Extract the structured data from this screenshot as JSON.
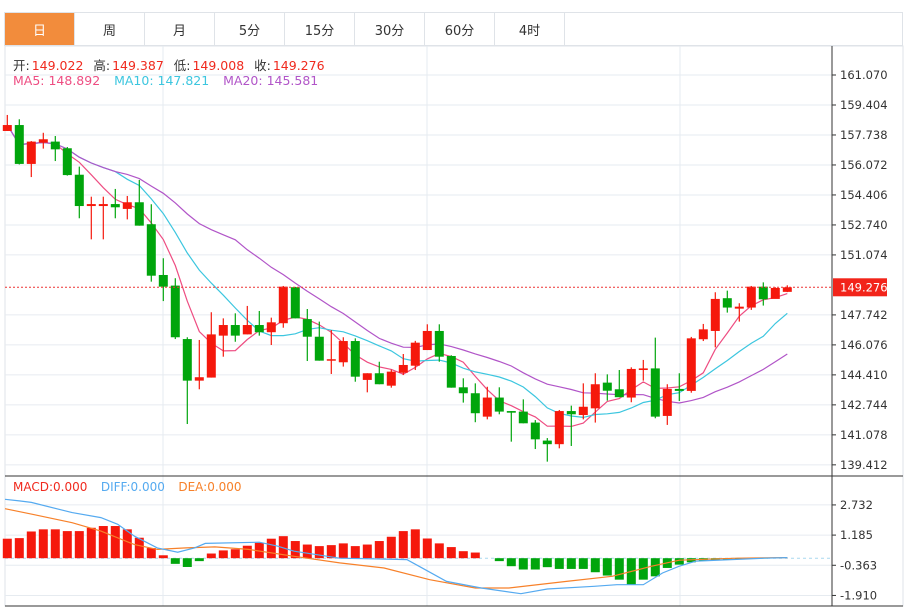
{
  "tabs": [
    {
      "label": "日",
      "active": true
    },
    {
      "label": "周"
    },
    {
      "label": "月"
    },
    {
      "label": "5分"
    },
    {
      "label": "15分"
    },
    {
      "label": "30分"
    },
    {
      "label": "60分"
    },
    {
      "label": "4时"
    }
  ],
  "ohlc_legend": {
    "open_label": "开:",
    "open": "149.022",
    "high_label": "高:",
    "high": "149.387",
    "low_label": "低:",
    "low": "149.008",
    "close_label": "收:",
    "close": "149.276"
  },
  "ma_legend": {
    "ma5": "MA5: 148.892",
    "ma10": "MA10: 147.821",
    "ma20": "MA20: 145.581"
  },
  "macd_legend": {
    "macd": "MACD:0.000",
    "diff": "DIFF:0.000",
    "dea": "DEA:0.000"
  },
  "colors": {
    "up": "#f5180c",
    "down": "#00a50c",
    "ma5": "#ee4d82",
    "ma10": "#3cc6df",
    "ma20": "#b155c8",
    "diff": "#55aaf0",
    "dea": "#f7812a",
    "accent": "#f28c3c",
    "grid": "#e6ebf0"
  },
  "chart_data": [
    {
      "type": "candlestick",
      "title": "",
      "ylim": [
        139.412,
        161.07
      ],
      "y_ticks": [
        "161.070",
        "159.404",
        "157.738",
        "156.072",
        "154.406",
        "152.740",
        "151.074",
        "147.742",
        "146.076",
        "144.410",
        "142.744",
        "141.078",
        "139.412"
      ],
      "current_price": "149.276",
      "ohlc": [
        [
          157.96,
          158.85,
          157.96,
          158.29
        ],
        [
          158.29,
          158.61,
          156.1,
          156.13
        ],
        [
          156.13,
          157.4,
          155.4,
          157.37
        ],
        [
          157.31,
          157.86,
          156.98,
          157.5
        ],
        [
          157.37,
          157.68,
          156.29,
          156.94
        ],
        [
          157.0,
          157.07,
          155.48,
          155.51
        ],
        [
          155.53,
          155.98,
          153.11,
          153.79
        ],
        [
          153.79,
          154.31,
          151.94,
          153.9
        ],
        [
          153.79,
          154.31,
          151.94,
          153.9
        ],
        [
          153.9,
          154.74,
          153.11,
          153.72
        ],
        [
          153.63,
          154.35,
          153.05,
          154.0
        ],
        [
          154.0,
          155.24,
          152.7,
          152.7
        ],
        [
          152.78,
          153.89,
          149.59,
          149.92
        ],
        [
          149.96,
          150.89,
          148.51,
          149.31
        ],
        [
          149.37,
          149.78,
          146.4,
          146.5
        ],
        [
          146.4,
          146.5,
          141.68,
          144.09
        ],
        [
          144.09,
          146.35,
          143.61,
          144.28
        ],
        [
          144.26,
          147.89,
          144.26,
          146.66
        ],
        [
          146.59,
          147.55,
          145.42,
          147.18
        ],
        [
          147.18,
          147.83,
          146.25,
          146.59
        ],
        [
          146.66,
          148.24,
          146.66,
          147.18
        ],
        [
          147.18,
          147.96,
          146.59,
          146.78
        ],
        [
          146.78,
          147.59,
          146.07,
          147.33
        ],
        [
          147.28,
          149.35,
          147.03,
          149.31
        ],
        [
          149.28,
          149.3,
          147.55,
          147.55
        ],
        [
          147.51,
          148.07,
          145.18,
          146.53
        ],
        [
          146.53,
          147.37,
          145.2,
          145.2
        ],
        [
          145.2,
          146.9,
          144.46,
          145.28
        ],
        [
          145.11,
          146.5,
          144.87,
          146.29
        ],
        [
          146.29,
          146.44,
          144.03,
          144.31
        ],
        [
          144.13,
          144.5,
          143.44,
          144.5
        ],
        [
          144.5,
          145.14,
          143.89,
          143.89
        ],
        [
          143.81,
          144.7,
          143.7,
          144.59
        ],
        [
          144.53,
          145.57,
          144.4,
          144.96
        ],
        [
          144.92,
          146.3,
          144.68,
          146.2
        ],
        [
          145.79,
          147.22,
          145.79,
          146.85
        ],
        [
          146.85,
          147.22,
          145.14,
          145.42
        ],
        [
          145.46,
          145.5,
          143.7,
          143.7
        ],
        [
          143.72,
          144.22,
          142.87,
          143.39
        ],
        [
          143.39,
          143.94,
          141.78,
          142.28
        ],
        [
          142.09,
          143.75,
          141.94,
          143.15
        ],
        [
          143.15,
          143.72,
          142.22,
          142.37
        ],
        [
          142.4,
          142.4,
          140.7,
          142.31
        ],
        [
          142.37,
          143.05,
          141.72,
          141.72
        ],
        [
          141.76,
          141.9,
          140.29,
          140.83
        ],
        [
          140.76,
          140.9,
          139.59,
          140.56
        ],
        [
          140.56,
          142.46,
          140.33,
          142.4
        ],
        [
          142.4,
          142.7,
          140.46,
          142.22
        ],
        [
          142.18,
          143.94,
          141.94,
          142.64
        ],
        [
          142.55,
          144.5,
          141.76,
          143.89
        ],
        [
          143.98,
          144.44,
          142.98,
          143.53
        ],
        [
          143.61,
          144.68,
          143.17,
          143.17
        ],
        [
          143.15,
          144.83,
          142.89,
          144.74
        ],
        [
          144.68,
          145.24,
          144.09,
          144.77
        ],
        [
          144.77,
          146.48,
          142.0,
          142.09
        ],
        [
          142.13,
          143.89,
          141.63,
          143.63
        ],
        [
          143.63,
          144.5,
          142.96,
          143.52
        ],
        [
          143.52,
          146.52,
          143.42,
          146.44
        ],
        [
          146.39,
          147.24,
          146.29,
          146.94
        ],
        [
          146.85,
          149.0,
          145.94,
          148.63
        ],
        [
          148.67,
          149.09,
          147.87,
          148.15
        ],
        [
          148.09,
          148.39,
          147.37,
          148.2
        ],
        [
          148.15,
          149.35,
          148.02,
          149.31
        ],
        [
          149.31,
          149.55,
          148.26,
          148.61
        ],
        [
          148.63,
          149.28,
          148.72,
          149.24
        ],
        [
          149.022,
          149.387,
          149.008,
          149.276
        ]
      ],
      "ma_periods": [
        5,
        10,
        20
      ]
    },
    {
      "type": "bar+line",
      "title": "MACD",
      "ylim": [
        -2.2,
        3.2
      ],
      "y_ticks": [
        "2.732",
        "1.185",
        "-0.363",
        "-1.910"
      ],
      "histogram": [
        1.0,
        1.03,
        1.37,
        1.48,
        1.48,
        1.39,
        1.39,
        1.56,
        1.65,
        1.65,
        1.48,
        1.05,
        0.52,
        0.15,
        -0.29,
        -0.45,
        -0.15,
        0.24,
        0.4,
        0.46,
        0.64,
        0.79,
        1.0,
        1.13,
        0.88,
        0.7,
        0.62,
        0.67,
        0.76,
        0.62,
        0.7,
        0.88,
        1.1,
        1.39,
        1.48,
        1.01,
        0.76,
        0.57,
        0.36,
        0.29,
        0,
        -0.15,
        -0.41,
        -0.58,
        -0.58,
        -0.46,
        -0.55,
        -0.55,
        -0.55,
        -0.72,
        -0.89,
        -1.1,
        -1.36,
        -1.1,
        -0.93,
        -0.5,
        -0.33,
        -0.21,
        -0.14,
        -0.1,
        -0.07,
        -0.05,
        -0.03,
        -0.02,
        -0.01,
        0
      ],
      "diff_points": [
        [
          -0.7,
          3.02
        ],
        [
          1,
          2.94
        ],
        [
          2,
          2.86
        ],
        [
          5.4,
          2.34
        ],
        [
          7.8,
          2.08
        ],
        [
          9.2,
          1.74
        ],
        [
          10.6,
          1.13
        ],
        [
          12.5,
          0.53
        ],
        [
          14.2,
          0.31
        ],
        [
          15.6,
          0.53
        ],
        [
          16.5,
          0.76
        ],
        [
          21,
          0.82
        ],
        [
          22.5,
          0.62
        ],
        [
          23.9,
          0.36
        ],
        [
          27.7,
          0
        ],
        [
          33.3,
          -0.07
        ],
        [
          34.3,
          -0.41
        ],
        [
          36.6,
          -1.19
        ],
        [
          39.5,
          -1.53
        ],
        [
          42.8,
          -1.82
        ],
        [
          45,
          -1.58
        ],
        [
          48.9,
          -1.44
        ],
        [
          50.8,
          -1.36
        ],
        [
          53,
          -1.36
        ],
        [
          54.6,
          -0.76
        ],
        [
          56,
          -0.41
        ],
        [
          57.4,
          -0.15
        ],
        [
          60.3,
          -0.07
        ],
        [
          63,
          0
        ],
        [
          65,
          0.03
        ]
      ],
      "dea_points": [
        [
          -0.7,
          2.54
        ],
        [
          2.1,
          2.25
        ],
        [
          5.4,
          1.82
        ],
        [
          7.8,
          1.39
        ],
        [
          10.6,
          0.7
        ],
        [
          12.5,
          0.45
        ],
        [
          14.9,
          0.53
        ],
        [
          17.3,
          0.58
        ],
        [
          20.1,
          0.45
        ],
        [
          23.9,
          0.1
        ],
        [
          27.7,
          -0.24
        ],
        [
          31.4,
          -0.5
        ],
        [
          35.2,
          -1.1
        ],
        [
          39,
          -1.53
        ],
        [
          41.8,
          -1.53
        ],
        [
          46.6,
          -1.19
        ],
        [
          50.4,
          -0.93
        ],
        [
          53.7,
          -0.41
        ],
        [
          56,
          -0.1
        ],
        [
          60.8,
          0
        ],
        [
          65,
          0.03
        ]
      ]
    }
  ]
}
